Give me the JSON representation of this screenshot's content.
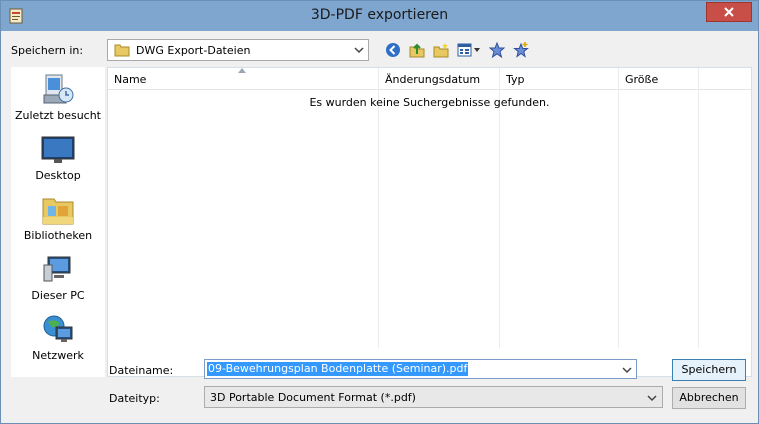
{
  "window": {
    "title": "3D-PDF exportieren",
    "close_icon": "close-icon"
  },
  "save_in": {
    "label": "Speichern in:",
    "folder": "DWG Export-Dateien"
  },
  "toolbar": {
    "icons": [
      "back-icon",
      "up-folder-icon",
      "new-folder-icon",
      "view-menu-icon",
      "favorite-icon",
      "add-favorite-icon"
    ]
  },
  "places": [
    {
      "label": "Zuletzt besucht",
      "icon": "recent-places-icon"
    },
    {
      "label": "Desktop",
      "icon": "desktop-icon"
    },
    {
      "label": "Bibliotheken",
      "icon": "libraries-icon"
    },
    {
      "label": "Dieser PC",
      "icon": "computer-icon"
    },
    {
      "label": "Netzwerk",
      "icon": "network-icon"
    }
  ],
  "list": {
    "columns": [
      "Name",
      "Änderungsdatum",
      "Typ",
      "Größe"
    ],
    "empty_message": "Es wurden keine Suchergebnisse gefunden."
  },
  "filename": {
    "label": "Dateiname:",
    "value": "09-Bewehrungsplan Bodenplatte (Seminar).pdf"
  },
  "filetype": {
    "label": "Dateityp:",
    "value": "3D Portable Document Format (*.pdf)"
  },
  "buttons": {
    "save": "Speichern",
    "cancel": "Abbrechen"
  },
  "colors": {
    "titlebar": "#7fa6cf",
    "close": "#c74f48",
    "selection": "#3399ff"
  }
}
